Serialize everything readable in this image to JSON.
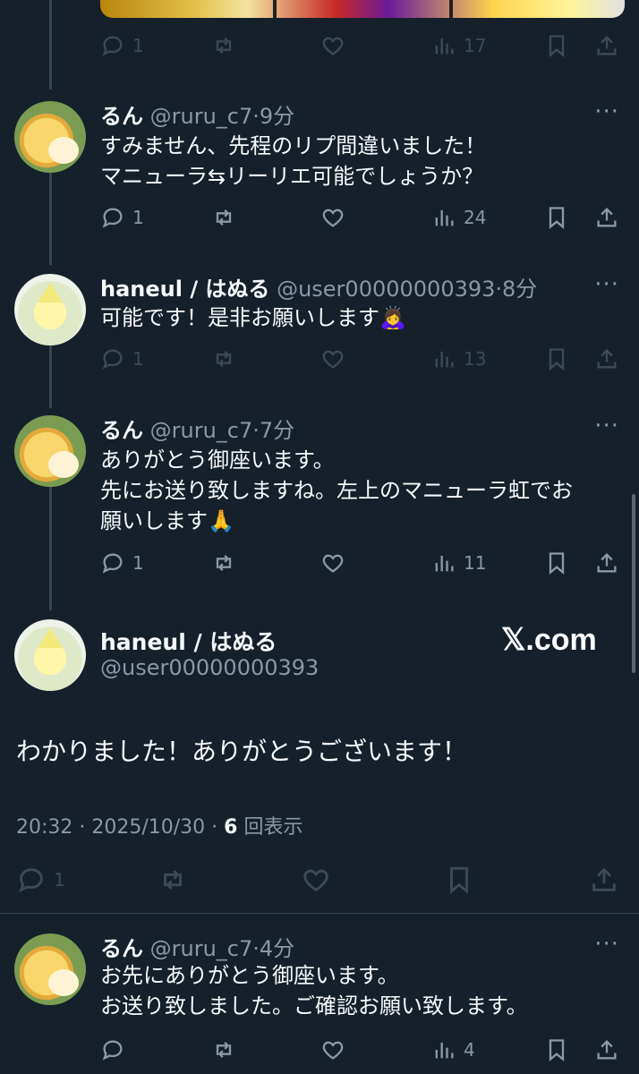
{
  "top_tweet": {
    "actions": {
      "replies": "1",
      "views": "17"
    }
  },
  "tweets": [
    {
      "name": "るん",
      "handle": "@ruru_c7",
      "time": "9分",
      "lines": [
        "すみません、先程のリプ間違いました！",
        "マニューラ⇆リーリエ可能でしょうか？"
      ],
      "replies": "1",
      "views": "24",
      "avatar": "pompompurin-avatar"
    },
    {
      "name": "haneul / はぬる",
      "handle": "@user00000000393",
      "time": "8分",
      "lines": [
        "可能です！是非お願いします"
      ],
      "emoji": "🙇‍♀️",
      "replies": "1",
      "views": "13",
      "avatar": "jirachi-avatar"
    },
    {
      "name": "るん",
      "handle": "@ruru_c7",
      "time": "7分",
      "lines": [
        "ありがとう御座います。",
        "先にお送り致しますね。左上のマニューラ虹でお",
        "願いします"
      ],
      "emoji": "🙏",
      "replies": "1",
      "views": "11",
      "avatar": "pompompurin-avatar"
    }
  ],
  "focus_tweet": {
    "name": "haneul / はぬる",
    "handle": "@user00000000393",
    "brand": "𝕏.com",
    "text": "わかりました！ありがとうございます！",
    "time": "20:32 · 2025/10/30 · ",
    "view_count": "6",
    "view_label": " 回表示",
    "replies": "1"
  },
  "last_tweet": {
    "name": "るん",
    "handle": "@ruru_c7",
    "time": "4分",
    "lines": [
      "お先にありがとう御座います。",
      "お送り致しました。ご確認お願い致します。"
    ],
    "replies": "",
    "views": "4"
  },
  "ui": {
    "more": "···",
    "dot": "·"
  },
  "colors": {
    "background": "#15202b",
    "text": "#f7f9f9",
    "muted": "#8b98a5",
    "divider": "#38444d"
  }
}
